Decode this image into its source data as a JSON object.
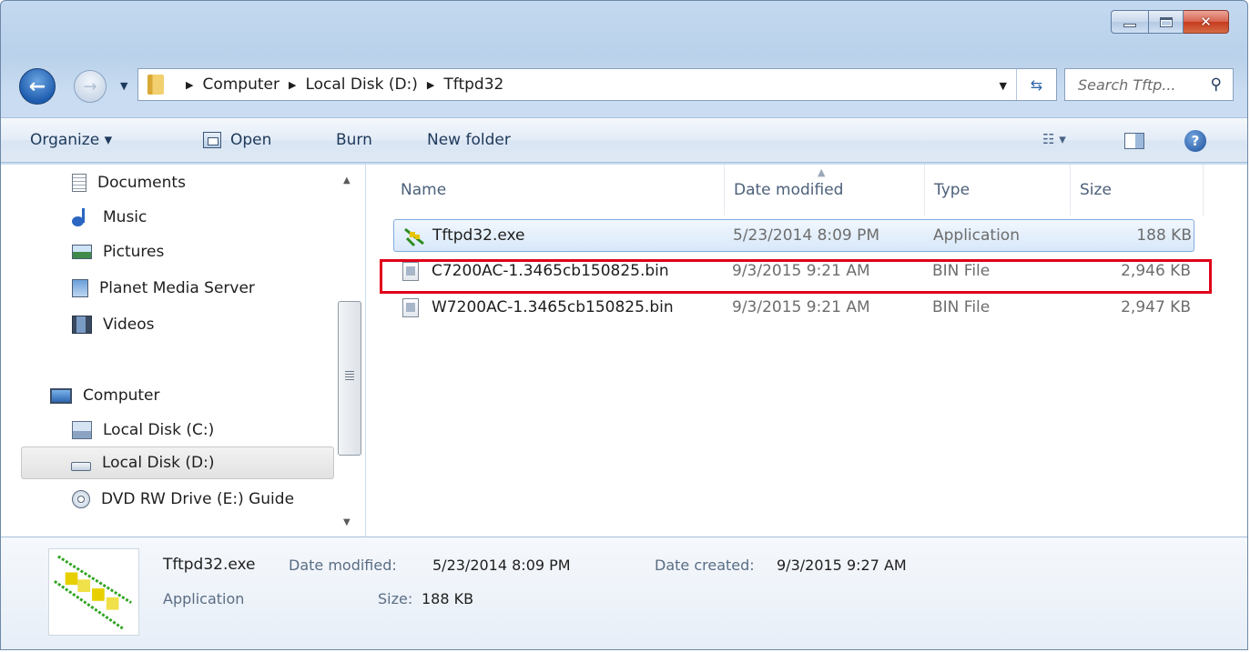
{
  "titlebar": {
    "minimize": "minimize",
    "maximize": "maximize",
    "close": "✕"
  },
  "address": {
    "crumbs": [
      "Computer",
      "Local Disk (D:)",
      "Tftpd32"
    ]
  },
  "search": {
    "placeholder": "Search Tftp..."
  },
  "toolbar": {
    "organize": "Organize ▾",
    "open": "Open",
    "burn": "Burn",
    "new_folder": "New folder",
    "views_arrow": "▾"
  },
  "nav": {
    "items": [
      {
        "label": "Documents",
        "icon": "documents-icon"
      },
      {
        "label": "Music",
        "icon": "music-icon"
      },
      {
        "label": "Pictures",
        "icon": "pictures-icon"
      },
      {
        "label": "Planet Media Server",
        "icon": "media-server-icon"
      },
      {
        "label": "Videos",
        "icon": "videos-icon"
      },
      {
        "label": "Computer",
        "icon": "computer-icon"
      },
      {
        "label": "Local Disk (C:)",
        "icon": "local-disk-icon"
      },
      {
        "label": "Local Disk (D:)",
        "icon": "local-disk-icon",
        "selected": true
      },
      {
        "label": "DVD RW Drive (E:) Guide",
        "icon": "dvd-drive-icon"
      }
    ]
  },
  "columns": {
    "name": "Name",
    "date_modified": "Date modified",
    "type": "Type",
    "size": "Size"
  },
  "files": [
    {
      "name": "Tftpd32.exe",
      "date": "5/23/2014 8:09 PM",
      "type": "Application",
      "size": "188 KB",
      "selected": true
    },
    {
      "name": "C7200AC-1.3465cb150825.bin",
      "date": "9/3/2015 9:21 AM",
      "type": "BIN File",
      "size": "2,946 KB",
      "highlighted": true
    },
    {
      "name": "W7200AC-1.3465cb150825.bin",
      "date": "9/3/2015 9:21 AM",
      "type": "BIN File",
      "size": "2,947 KB"
    }
  ],
  "details": {
    "name": "Tftpd32.exe",
    "type": "Application",
    "date_modified_label": "Date modified:",
    "date_modified": "5/23/2014 8:09 PM",
    "size_label": "Size:",
    "size": "188 KB",
    "date_created_label": "Date created:",
    "date_created": "9/3/2015 9:27 AM"
  },
  "colors": {
    "highlight_box": "#e1001a",
    "selection": "#d8e8f9"
  }
}
